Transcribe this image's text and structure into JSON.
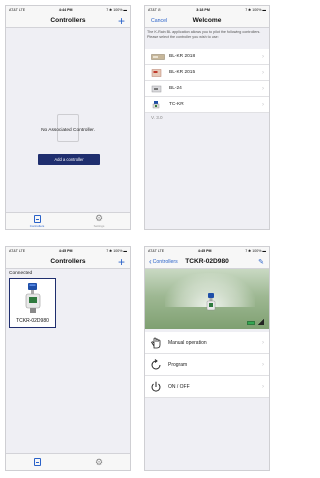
{
  "panel1": {
    "status": {
      "left": "AT&T  LTE",
      "time": "4:44 PM",
      "right": "7 ✱ 100% ▬"
    },
    "title": "Controllers",
    "plus": "+",
    "empty_text": "No Associated Controller.",
    "add_button": "Add a controller",
    "tabs": [
      {
        "label": "Controllers"
      },
      {
        "label": "Settings"
      }
    ]
  },
  "panel2": {
    "status": {
      "left": "AT&T ✆",
      "time": "3:18 PM",
      "right": "7 ✱ 100% ▬"
    },
    "title": "Welcome",
    "cancel": "Cancel",
    "description": "The K-Rain BL application allows you to pilot the following controllers. Please select the controller you wish to use:",
    "items": [
      {
        "label": "BL-KR 2018"
      },
      {
        "label": "BL-KR 2015"
      },
      {
        "label": "BL-24"
      },
      {
        "label": "TC-KR"
      }
    ],
    "version": "V. 3.0"
  },
  "panel3": {
    "status": {
      "left": "AT&T  LTE",
      "time": "4:45 PM",
      "right": "7 ✱ 100% ▬"
    },
    "title": "Controllers",
    "plus": "+",
    "section": "Connected",
    "card_label": "TCKR-02D980"
  },
  "panel4": {
    "status": {
      "left": "AT&T  LTE",
      "time": "4:45 PM",
      "right": "7 ✱ 100% ▬"
    },
    "back": "Controllers",
    "title": "TCKR-02D980",
    "edit": "✎",
    "menu": [
      {
        "label": "Manual operation"
      },
      {
        "label": "Program"
      },
      {
        "label": "ON / OFF"
      }
    ]
  },
  "colors": {
    "accent": "#2a62c9",
    "button": "#1f2e6e",
    "battery": "#34a853"
  }
}
